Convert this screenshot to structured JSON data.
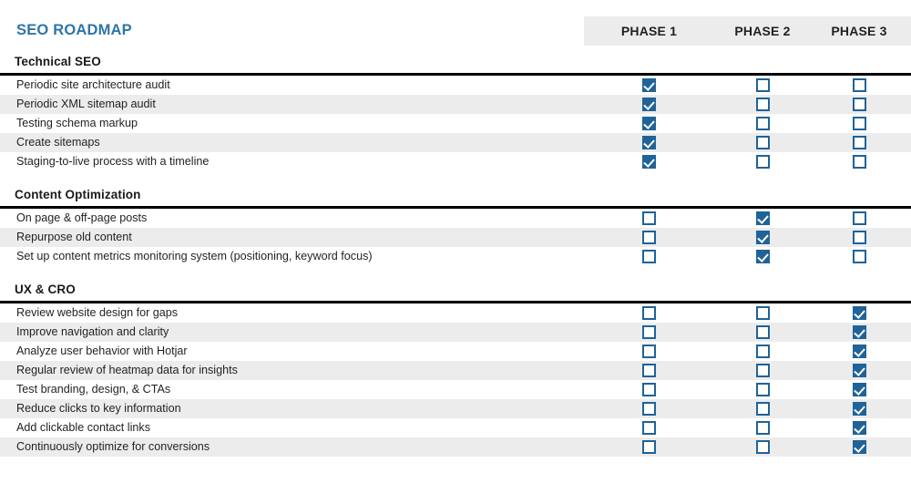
{
  "header": {
    "title": "SEO ROADMAP",
    "title_color": "#2e75a8",
    "band_color": "#ececec",
    "phases": [
      {
        "label": "PHASE 1"
      },
      {
        "label": "PHASE 2"
      },
      {
        "label": "PHASE 3"
      }
    ]
  },
  "theme": {
    "checkbox_checked_fill": "#1f6399",
    "checkbox_border": "#1f6399",
    "row_alt_background": "#ececec",
    "section_rule_color": "#000000",
    "text_color": "#231f20"
  },
  "sections": [
    {
      "title": "Technical SEO",
      "rows": [
        {
          "label": "Periodic site architecture audit",
          "checks": [
            true,
            false,
            false
          ]
        },
        {
          "label": "Periodic XML sitemap audit",
          "checks": [
            true,
            false,
            false
          ]
        },
        {
          "label": "Testing schema markup",
          "checks": [
            true,
            false,
            false
          ]
        },
        {
          "label": "Create sitemaps",
          "checks": [
            true,
            false,
            false
          ]
        },
        {
          "label": "Staging-to-live process with a timeline",
          "checks": [
            true,
            false,
            false
          ]
        }
      ]
    },
    {
      "title": "Content Optimization",
      "rows": [
        {
          "label": "On page & off-page posts",
          "checks": [
            false,
            true,
            false
          ]
        },
        {
          "label": "Repurpose old content",
          "checks": [
            false,
            true,
            false
          ]
        },
        {
          "label": "Set up content metrics monitoring system (positioning, keyword focus)",
          "checks": [
            false,
            true,
            false
          ]
        }
      ]
    },
    {
      "title": "UX & CRO",
      "rows": [
        {
          "label": "Review website design for gaps",
          "checks": [
            false,
            false,
            true
          ]
        },
        {
          "label": "Improve navigation and clarity",
          "checks": [
            false,
            false,
            true
          ]
        },
        {
          "label": "Analyze user behavior with Hotjar",
          "checks": [
            false,
            false,
            true
          ]
        },
        {
          "label": "Regular review of heatmap data for insights",
          "checks": [
            false,
            false,
            true
          ]
        },
        {
          "label": "Test branding, design, & CTAs",
          "checks": [
            false,
            false,
            true
          ]
        },
        {
          "label": "Reduce clicks to key information",
          "checks": [
            false,
            false,
            true
          ]
        },
        {
          "label": "Add clickable contact links",
          "checks": [
            false,
            false,
            true
          ]
        },
        {
          "label": "Continuously optimize for conversions",
          "checks": [
            false,
            false,
            true
          ]
        }
      ]
    }
  ]
}
